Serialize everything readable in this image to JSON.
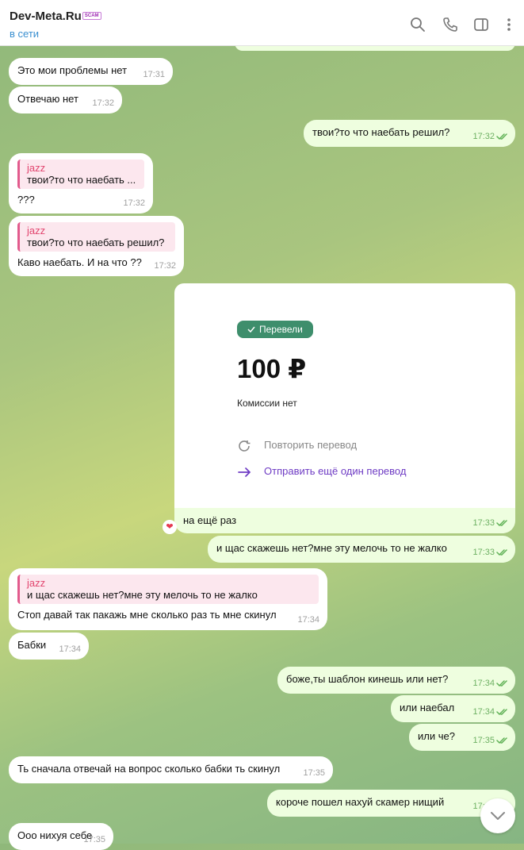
{
  "header": {
    "title": "Dev-Meta.Ru",
    "badge": "SCAM",
    "status": "в сети"
  },
  "icons": [
    "search-icon",
    "phone-icon",
    "sidebar-icon",
    "more-icon",
    "chevron-down-icon",
    "heart-icon",
    "check-icon",
    "repeat-icon",
    "arrow-right-icon"
  ],
  "messages": [
    {
      "text": "Это мои проблемы нет",
      "time": "17:31"
    },
    {
      "text": "Отвечаю нет",
      "time": "17:32"
    },
    {
      "text": "твои?то что наебать решил?",
      "time": "17:32"
    },
    {
      "reply_name": "jazz",
      "reply_text": "твои?то что наебать ...",
      "text": "???",
      "time": "17:32"
    },
    {
      "reply_name": "jazz",
      "reply_text": "твои?то что наебать решил?",
      "text": "Каво наебать. И на что ??",
      "time": "17:32"
    },
    {
      "text": "на ещё раз",
      "time": "17:33"
    },
    {
      "text": "и щас скажешь нет?мне эту мелочь то не жалко",
      "time": "17:33"
    },
    {
      "reply_name": "jazz",
      "reply_text": "и щас скажешь нет?мне эту мелочь то не жалко",
      "text": "Стоп давай так пакажь мне сколько раз ть мне скинул",
      "time": "17:34"
    },
    {
      "text": "Бабки",
      "time": "17:34"
    },
    {
      "text": "боже,ты шаблон кинешь или нет?",
      "time": "17:34"
    },
    {
      "text": "или наебал",
      "time": "17:34"
    },
    {
      "text": "или че?",
      "time": "17:35"
    },
    {
      "text": "Ть сначала отвечай на вопрос сколько бабки ть скинул",
      "time": "17:35"
    },
    {
      "text": "короче пошел нахуй скамер нищий",
      "time": "17:35"
    },
    {
      "text": "Ооо нихуя себе",
      "time": "17:35"
    }
  ],
  "transfer": {
    "status": "Перевели",
    "amount": "100 ₽",
    "fee": "Комиссии нет",
    "repeat": "Повторить перевод",
    "send_again": "Отправить ещё один перевод"
  },
  "reaction": "❤"
}
